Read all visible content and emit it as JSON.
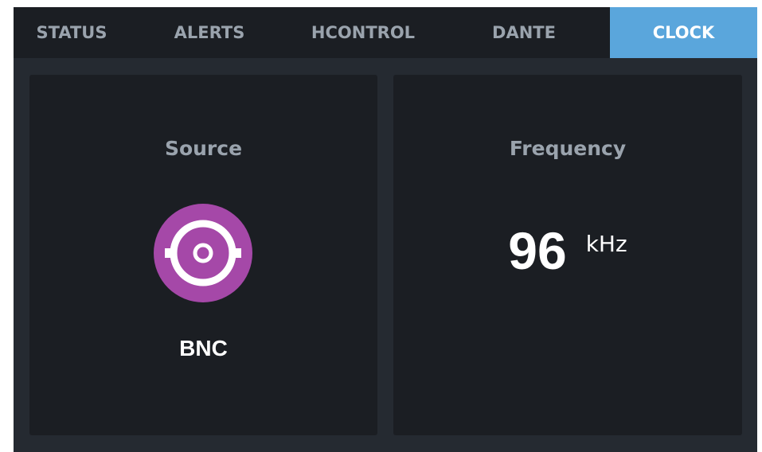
{
  "tabs": [
    {
      "label": "STATUS",
      "active": false
    },
    {
      "label": "ALERTS",
      "active": false
    },
    {
      "label": "HCONTROL",
      "active": false
    },
    {
      "label": "DANTE",
      "active": false
    },
    {
      "label": "CLOCK",
      "active": true
    }
  ],
  "source_panel": {
    "title": "Source",
    "icon": "bnc-connector-icon",
    "value": "BNC"
  },
  "frequency_panel": {
    "title": "Frequency",
    "value": "96",
    "unit": "kHz"
  },
  "colors": {
    "background": "#252a31",
    "panel": "#1b1e23",
    "active_tab": "#5aa6dc",
    "inactive_text": "#9aa3ad",
    "bnc_icon": "#a548a8"
  }
}
